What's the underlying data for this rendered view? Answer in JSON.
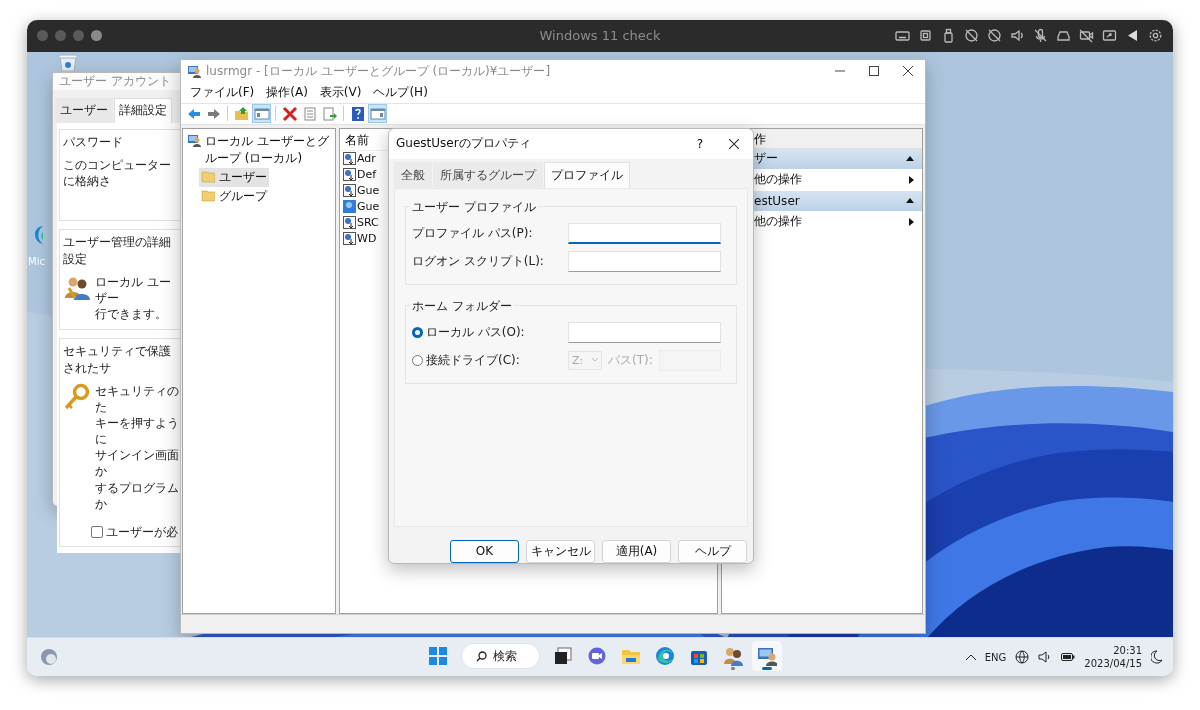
{
  "mac_window": {
    "title": "Windows 11 check"
  },
  "desktop": {
    "icons": [
      {
        "kind": "recycle_bin"
      },
      {
        "kind": "edge",
        "label": "Mic"
      }
    ]
  },
  "account_window": {
    "title": "ユーザー アカウント",
    "tabs": [
      {
        "label": "ユーザー",
        "selected": false
      },
      {
        "label": "詳細設定",
        "selected": true
      }
    ],
    "groups": [
      {
        "title": "パスワード",
        "kind": "plain",
        "lines": [
          "このコンピューターに格納さ"
        ]
      },
      {
        "title": "ユーザー管理の詳細設定",
        "kind": "users",
        "lines": [
          "ローカル ユーザー",
          "行できます。"
        ]
      },
      {
        "title": "セキュリティで保護されたサ",
        "kind": "key",
        "lines": [
          "セキュリティのた",
          "キーを押すように",
          "サインイン画面か",
          "するプログラムか"
        ],
        "checkbox": {
          "label": "ユーザーが必",
          "checked": false
        }
      }
    ]
  },
  "main_window": {
    "title": "lusrmgr - [ローカル ユーザーとグループ (ローカル)¥ユーザー]",
    "menu": [
      "ファイル(F)",
      "操作(A)",
      "表示(V)",
      "ヘルプ(H)"
    ],
    "toolbar": [
      {
        "kind": "back",
        "on": false
      },
      {
        "kind": "forward",
        "on": false
      },
      {
        "kind": "sep"
      },
      {
        "kind": "up",
        "on": false
      },
      {
        "kind": "tree_toggle",
        "on": true
      },
      {
        "kind": "sep"
      },
      {
        "kind": "delete",
        "on": false
      },
      {
        "kind": "properties",
        "on": false
      },
      {
        "kind": "export",
        "on": false
      },
      {
        "kind": "sep"
      },
      {
        "kind": "help",
        "on": false
      },
      {
        "kind": "action_toggle",
        "on": true
      }
    ],
    "tree": [
      {
        "label": "ローカル ユーザーとグループ (ローカル)",
        "selected": false,
        "children": [
          {
            "label": "ユーザー",
            "selected": true
          },
          {
            "label": "グループ",
            "selected": false
          }
        ]
      }
    ],
    "list": {
      "columns": [
        "名前"
      ],
      "rows": [
        {
          "name": "Adr",
          "selected": false
        },
        {
          "name": "Def",
          "selected": false
        },
        {
          "name": "Gue",
          "selected": false
        },
        {
          "name": "Gue",
          "selected": true
        },
        {
          "name": "SRC",
          "selected": false
        },
        {
          "name": "WD",
          "selected": false
        }
      ]
    },
    "actions": {
      "column_1": "作",
      "sections": [
        {
          "title": "ザー",
          "expanded": true,
          "items": [
            "他の操作"
          ]
        },
        {
          "title": "estUser",
          "expanded": true,
          "items": [
            "他の操作"
          ]
        }
      ]
    }
  },
  "dialog": {
    "title": "GuestUserのプロパティ",
    "help": "?",
    "tabs": [
      {
        "label": "全般",
        "selected": false
      },
      {
        "label": "所属するグループ",
        "selected": false
      },
      {
        "label": "プロファイル",
        "selected": true
      }
    ],
    "groups": [
      {
        "title": "ユーザー プロファイル",
        "rows": [
          {
            "kind": "field",
            "label": "プロファイル パス(P):",
            "focused": true
          },
          {
            "kind": "field",
            "label": "ログオン スクリプト(L):",
            "focused": false
          }
        ]
      },
      {
        "title": "ホーム フォルダー",
        "rows": [
          {
            "kind": "radio_field",
            "label": "ローカル パス(O):",
            "selected": true
          },
          {
            "kind": "radio_drive",
            "label": "接続ドライブ(C):",
            "selected": false,
            "drive": "Z:",
            "path_label": "パス(T):",
            "disabled": true
          }
        ]
      }
    ],
    "buttons": [
      {
        "label": "OK",
        "default": true
      },
      {
        "label": "キャンセル",
        "default": false
      },
      {
        "label": "適用(A)",
        "default": false
      },
      {
        "label": "ヘルプ",
        "default": false
      }
    ]
  },
  "taskbar": {
    "apps": [
      {
        "kind": "start",
        "active": false
      },
      {
        "kind": "search",
        "label": "検索"
      },
      {
        "kind": "taskview",
        "active": false
      },
      {
        "kind": "meet",
        "active": false
      },
      {
        "kind": "explorer",
        "active": false
      },
      {
        "kind": "edge",
        "active": false
      },
      {
        "kind": "store",
        "active": false
      },
      {
        "kind": "users",
        "active": false,
        "running": true
      },
      {
        "kind": "lusrmgr",
        "active": true,
        "running": true
      }
    ],
    "language": "ENG",
    "time": "20:31",
    "date": "2023/04/15"
  }
}
